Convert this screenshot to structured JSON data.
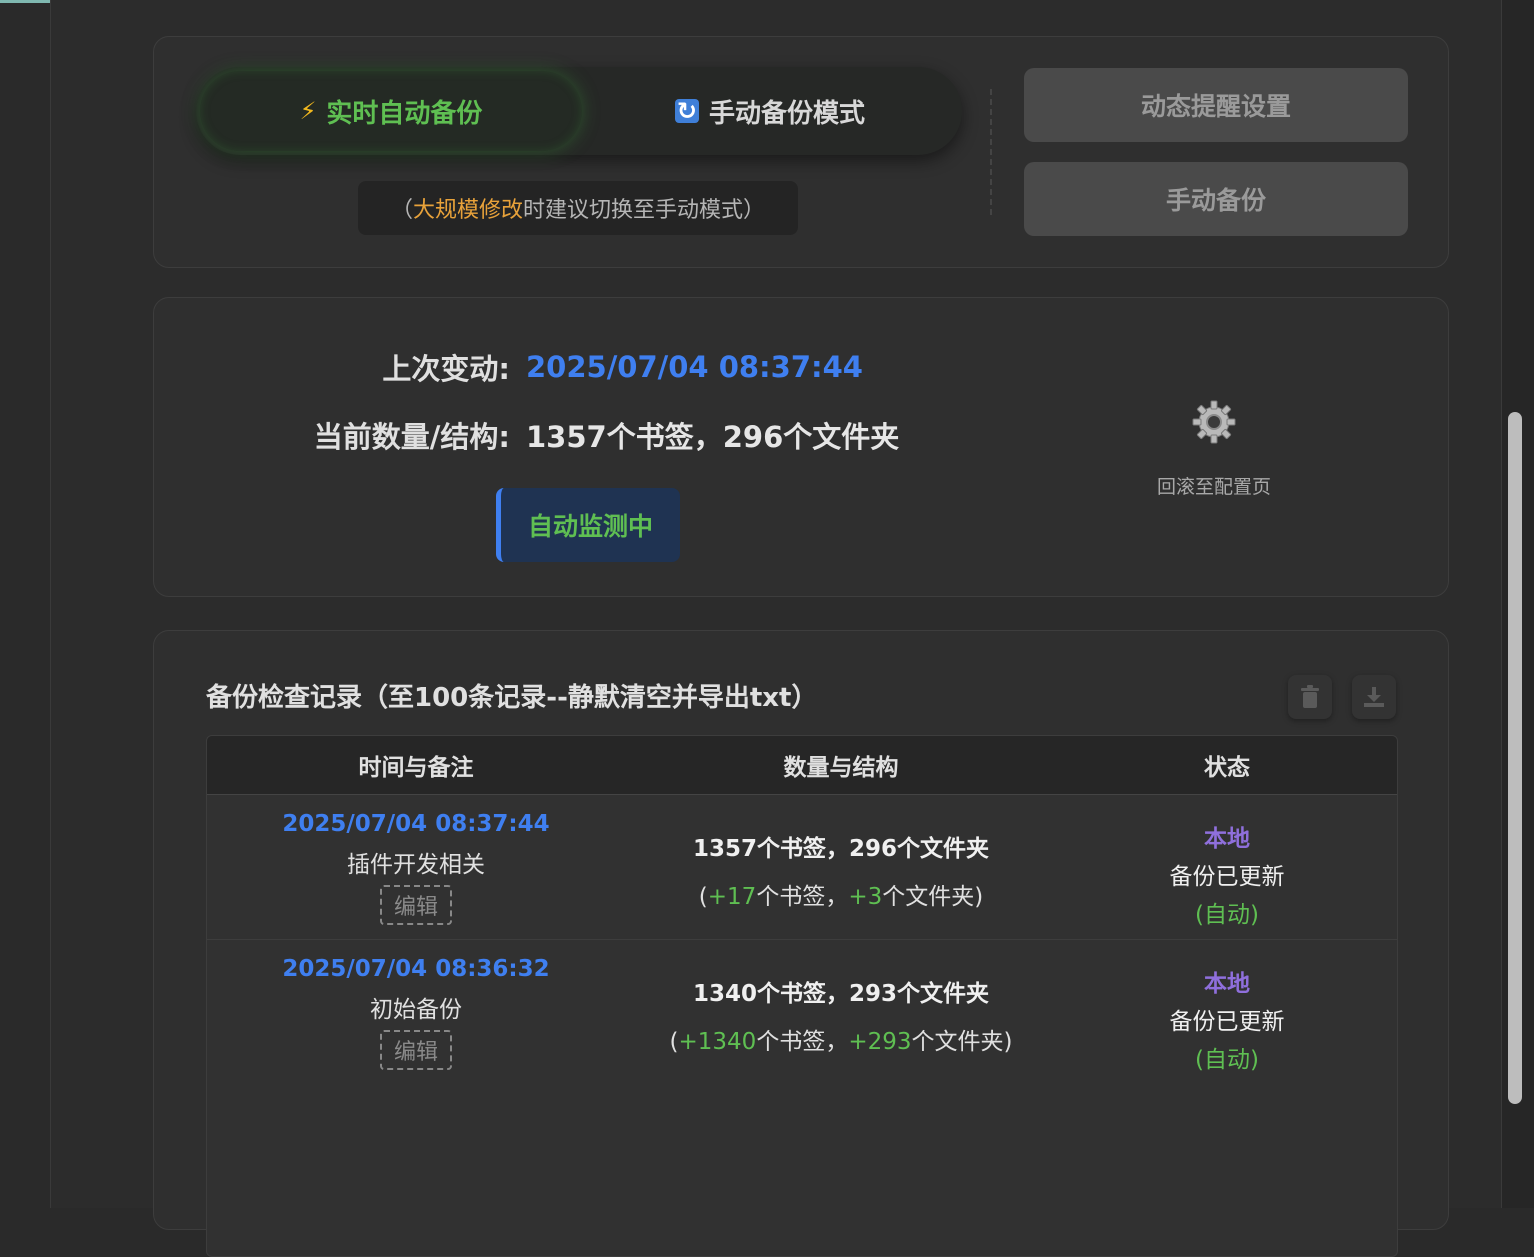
{
  "mode": {
    "realtime_label": "实时自动备份",
    "manual_mode_label": "手动备份模式",
    "hint_prefix": "（",
    "hint_emphasis": "大规模修改",
    "hint_suffix": "时建议切换至手动模式）",
    "reminder_button": "动态提醒设置",
    "manual_backup_button": "手动备份"
  },
  "status": {
    "last_change_label": "上次变动:",
    "last_change_value": "2025/07/04 08:37:44",
    "count_label": "当前数量/结构:",
    "count_value": "1357个书签，296个文件夹",
    "monitor_badge": "自动监测中",
    "config_link": "回滚至配置页"
  },
  "log": {
    "title": "备份检查记录（至100条记录--静默清空并导出txt）",
    "columns": [
      "时间与备注",
      "数量与结构",
      "状态"
    ],
    "rows": [
      {
        "time": "2025/07/04 08:37:44",
        "note": "插件开发相关",
        "edit": "编辑",
        "count": "1357个书签，296个文件夹",
        "diff_open": "(",
        "diff_bookmarks": "+17",
        "diff_mid": "个书签，",
        "diff_folders": "+3",
        "diff_close": "个文件夹)",
        "status_location": "本地",
        "status_text": "备份已更新",
        "status_mode": "(自动)"
      },
      {
        "time": "2025/07/04 08:36:32",
        "note": "初始备份",
        "edit": "编辑",
        "count": "1340个书签，293个文件夹",
        "diff_open": "(",
        "diff_bookmarks": "+1340",
        "diff_mid": "个书签，",
        "diff_folders": "+293",
        "diff_close": "个文件夹)",
        "status_location": "本地",
        "status_text": "备份已更新",
        "status_mode": "(自动)"
      }
    ]
  },
  "icons": {
    "realtime": "bolt-icon",
    "manual_mode": "sync-icon",
    "config": "gear-icon",
    "clear": "trash-icon",
    "export": "download-icon"
  },
  "colors": {
    "accent_blue": "#3f7ff0",
    "accent_green": "#5fbf52",
    "accent_orange": "#e8a23a",
    "accent_purple": "#8f6fdc"
  }
}
